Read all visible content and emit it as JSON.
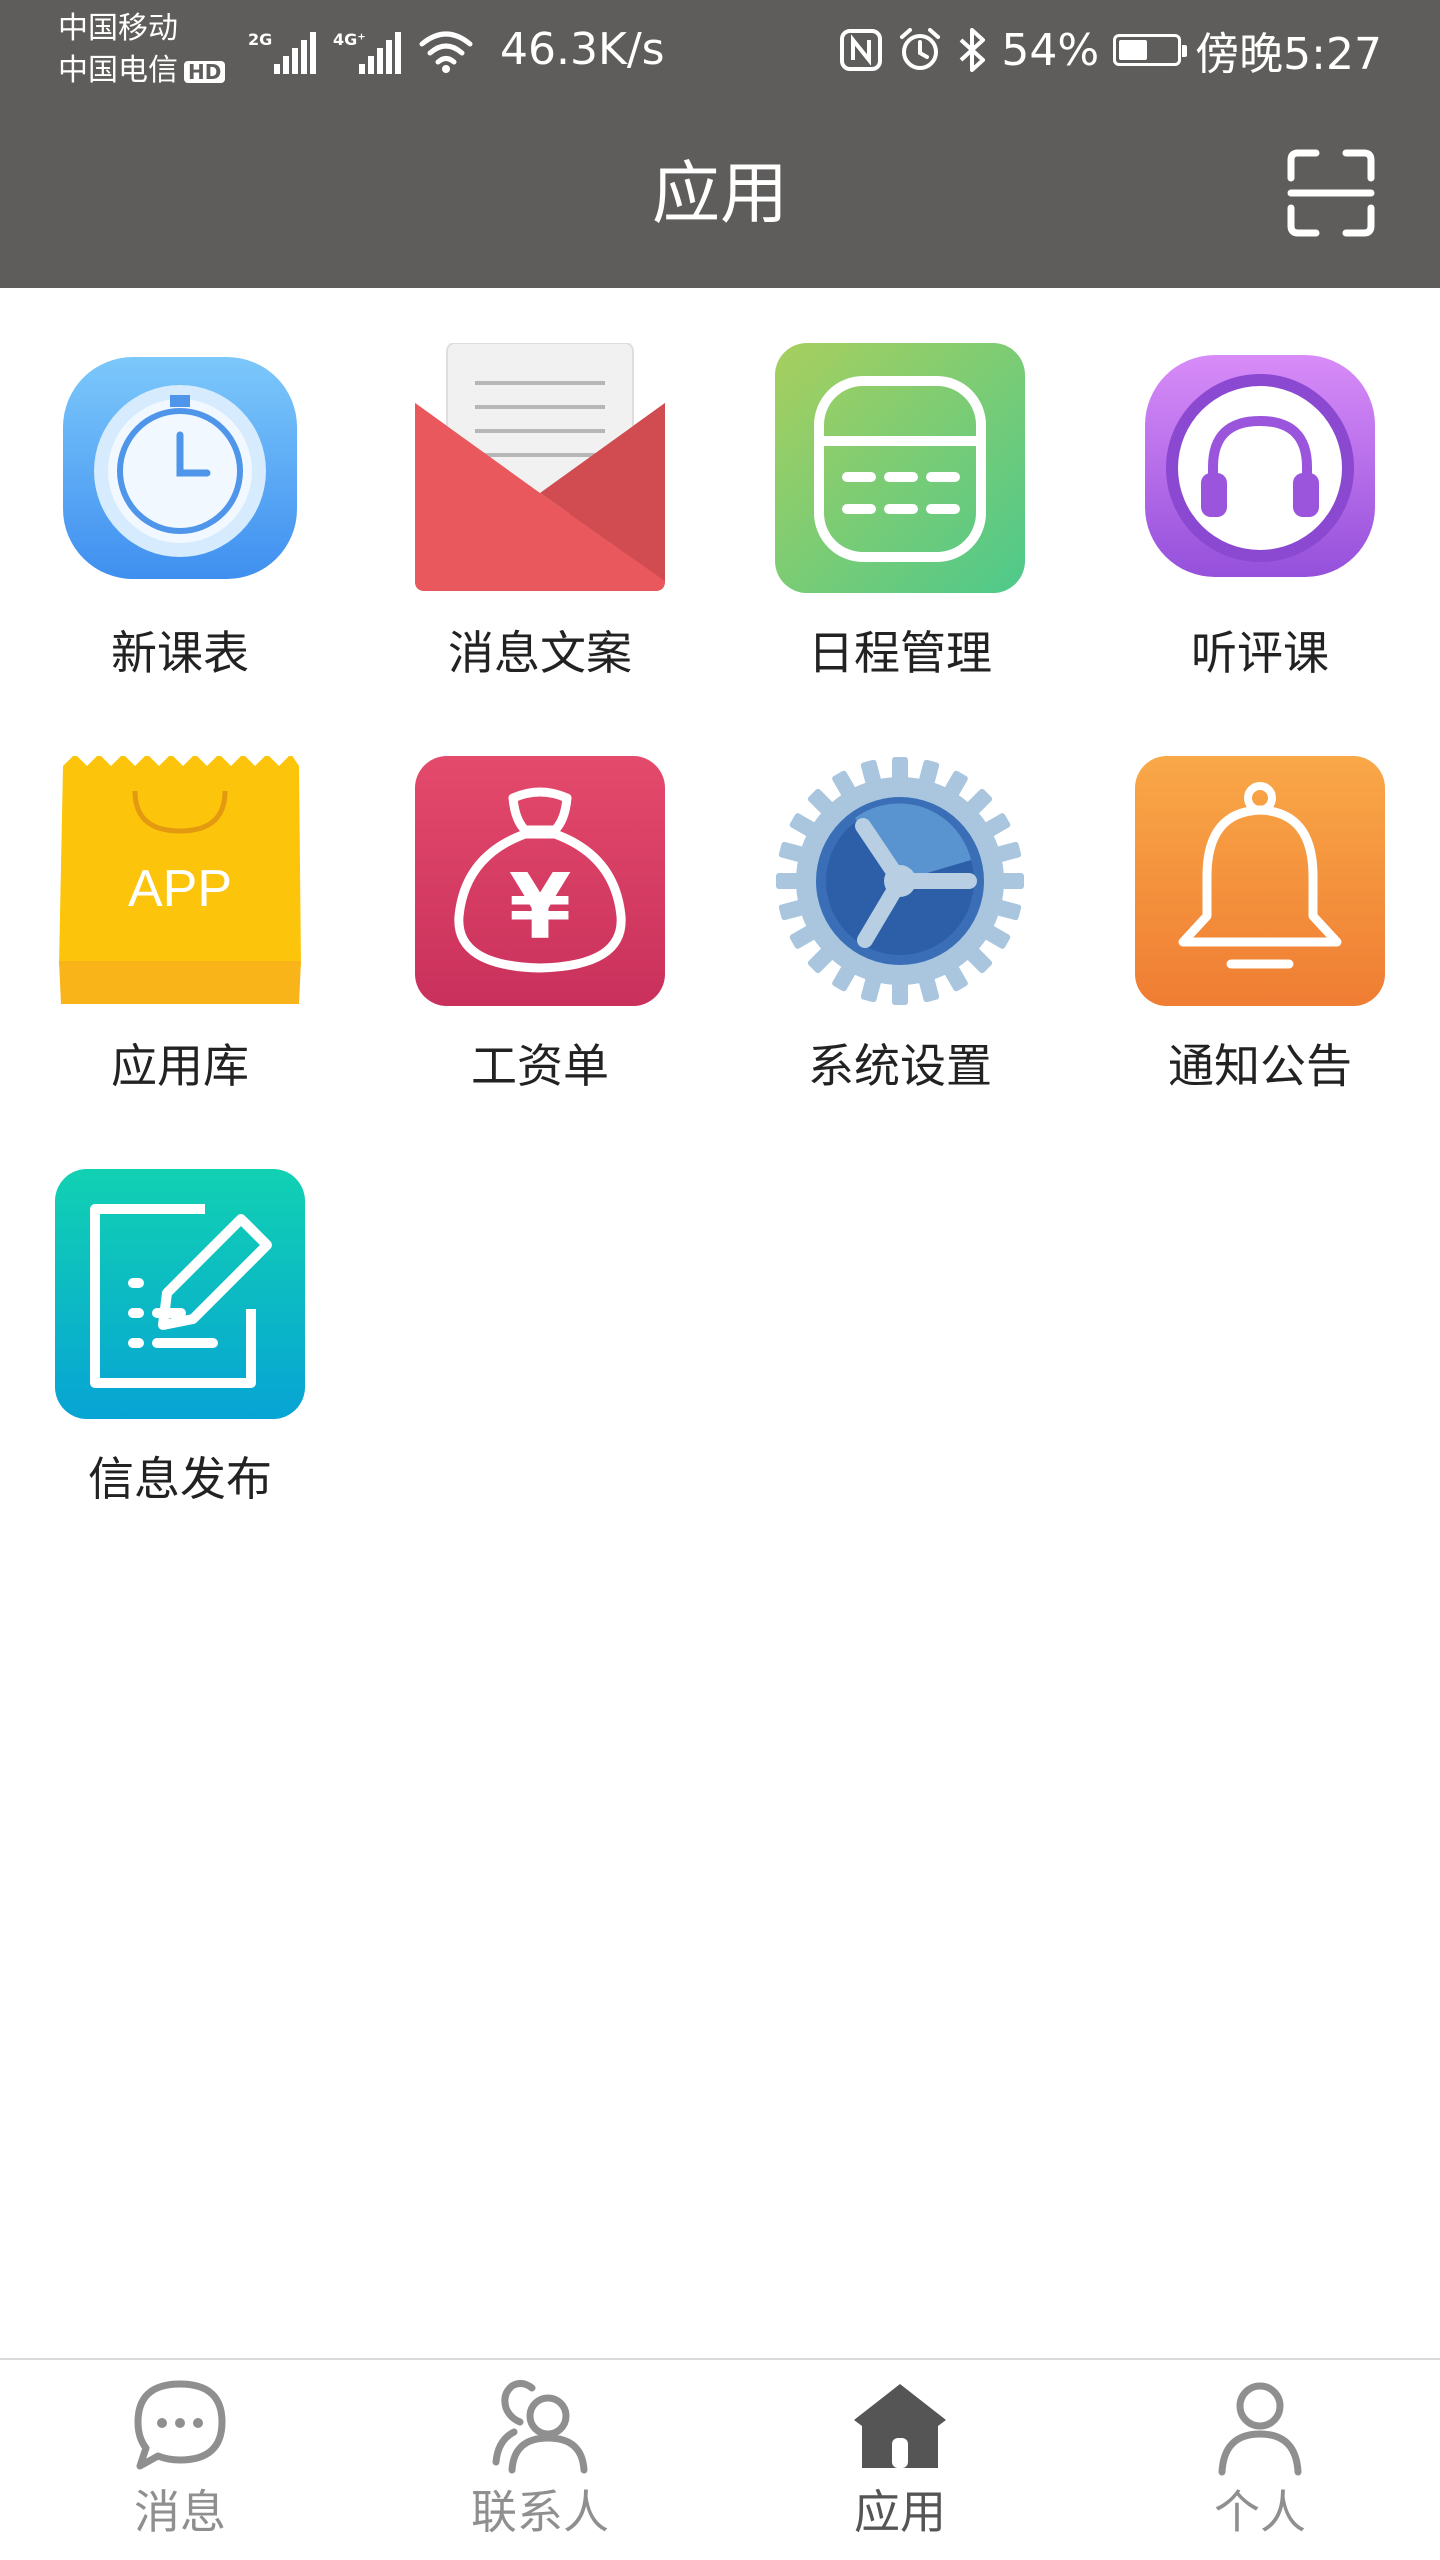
{
  "status_bar": {
    "carrier_1": "中国移动",
    "carrier_2": "中国电信",
    "hd_badge": "HD",
    "signal_1_tag": "2G",
    "signal_2_tag": "4G⁺",
    "net_speed": "46.3K/s",
    "battery_level_percent": 54,
    "battery_text": "54%",
    "time": "傍晚5:27"
  },
  "header": {
    "title": "应用"
  },
  "apps": [
    {
      "label": "新课表",
      "icon": "stopwatch-icon"
    },
    {
      "label": "消息文案",
      "icon": "envelope-icon"
    },
    {
      "label": "日程管理",
      "icon": "calendar-icon"
    },
    {
      "label": "听评课",
      "icon": "headphones-icon"
    },
    {
      "label": "应用库",
      "icon": "app-bag-icon",
      "icon_text": "APP"
    },
    {
      "label": "工资单",
      "icon": "money-bag-icon",
      "icon_text": "¥"
    },
    {
      "label": "系统设置",
      "icon": "gear-icon"
    },
    {
      "label": "通知公告",
      "icon": "bell-icon"
    },
    {
      "label": "信息发布",
      "icon": "edit-note-icon"
    }
  ],
  "bottom_nav": {
    "items": [
      {
        "label": "消息",
        "icon": "chat-bubble-icon",
        "active": false
      },
      {
        "label": "联系人",
        "icon": "contacts-icon",
        "active": false
      },
      {
        "label": "应用",
        "icon": "home-icon",
        "active": true
      },
      {
        "label": "个人",
        "icon": "person-icon",
        "active": false
      }
    ]
  },
  "colors": {
    "header_bg": "#5e5d5b",
    "nav_active": "#555555",
    "nav_inactive": "#8f8f8f"
  }
}
